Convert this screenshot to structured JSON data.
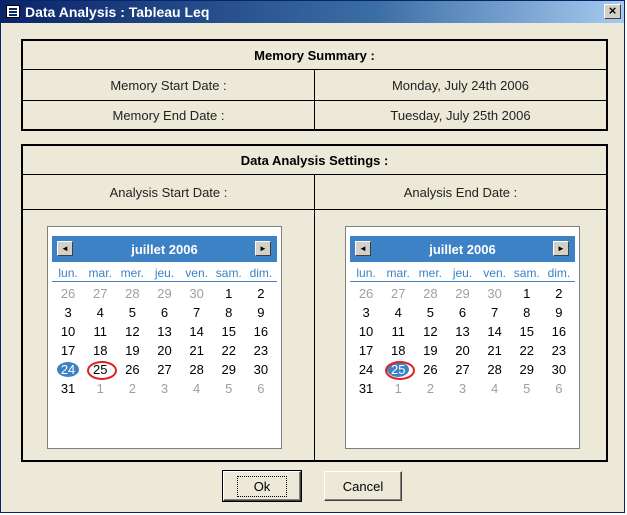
{
  "window": {
    "title": "Data Analysis : Tableau Leq",
    "close_label": "×"
  },
  "memory": {
    "header": "Memory Summary :",
    "start_label": "Memory Start Date :",
    "start_value": "Monday, July 24th 2006",
    "end_label": "Memory End Date :",
    "end_value": "Tuesday, July 25th 2006"
  },
  "settings": {
    "header": "Data Analysis Settings :",
    "start_label": "Analysis Start Date :",
    "end_label": "Analysis End Date :"
  },
  "calendars": [
    {
      "month_label": "juillet 2006",
      "prev_icon": "◄",
      "next_icon": "►",
      "weekdays": [
        "lun.",
        "mar.",
        "mer.",
        "jeu.",
        "ven.",
        "sam.",
        "dim."
      ],
      "days": [
        "26",
        "27",
        "28",
        "29",
        "30",
        "1",
        "2",
        "3",
        "4",
        "5",
        "6",
        "7",
        "8",
        "9",
        "10",
        "11",
        "12",
        "13",
        "14",
        "15",
        "16",
        "17",
        "18",
        "19",
        "20",
        "21",
        "22",
        "23",
        "24",
        "25",
        "26",
        "27",
        "28",
        "29",
        "30",
        "31",
        "1",
        "2",
        "3",
        "4",
        "5",
        "6"
      ],
      "selected_day": "24",
      "today_day": "25"
    },
    {
      "month_label": "juillet 2006",
      "prev_icon": "◄",
      "next_icon": "►",
      "weekdays": [
        "lun.",
        "mar.",
        "mer.",
        "jeu.",
        "ven.",
        "sam.",
        "dim."
      ],
      "days": [
        "26",
        "27",
        "28",
        "29",
        "30",
        "1",
        "2",
        "3",
        "4",
        "5",
        "6",
        "7",
        "8",
        "9",
        "10",
        "11",
        "12",
        "13",
        "14",
        "15",
        "16",
        "17",
        "18",
        "19",
        "20",
        "21",
        "22",
        "23",
        "24",
        "25",
        "26",
        "27",
        "28",
        "29",
        "30",
        "31",
        "1",
        "2",
        "3",
        "4",
        "5",
        "6"
      ],
      "selected_day": "25",
      "today_day": "25"
    }
  ],
  "buttons": {
    "ok": "Ok",
    "cancel": "Cancel"
  },
  "colors": {
    "accent": "#3c82c4",
    "today_ring": "#e02020",
    "panel_bg": "#ece9d8"
  }
}
